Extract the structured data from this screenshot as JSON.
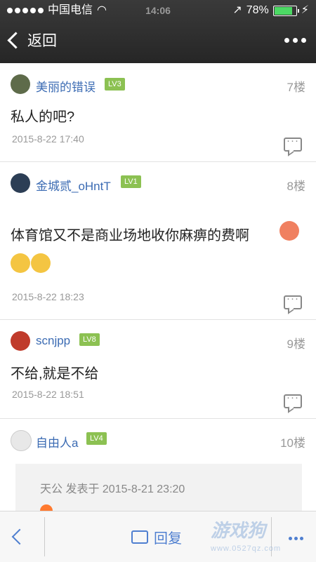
{
  "status_bar": {
    "carrier": "中国电信",
    "time": "14:06",
    "battery_percent": "78%",
    "battery_level": 0.78
  },
  "nav": {
    "back_label": "返回",
    "more_icon": "more-dots-icon"
  },
  "posts": [
    {
      "username": "美丽的错误",
      "level": "LV3",
      "floor": "7楼",
      "content": "私人的吧?",
      "timestamp": "2015-8-22 17:40"
    },
    {
      "username": "金城贰_oHntT",
      "level": "LV1",
      "floor": "8楼",
      "content": "体育馆又不是商业场地收你麻痹的费啊",
      "timestamp": "2015-8-22 18:23"
    },
    {
      "username": "scnjpp",
      "level": "LV8",
      "floor": "9楼",
      "content": "不给,就是不给",
      "timestamp": "2015-8-22 18:51"
    },
    {
      "username": "自由人a",
      "level": "LV4",
      "floor": "10楼",
      "quote": "天公 发表于 2015-8-21 23:20"
    }
  ],
  "toolbar": {
    "reply_label": "回复",
    "watermark": "游戏狗",
    "watermark_url": "www.0527qz.com"
  },
  "colors": {
    "accent": "#4f7fd0",
    "username": "#3b6bb3",
    "level_badge": "#8cc152",
    "header": "#2e2e2e"
  }
}
